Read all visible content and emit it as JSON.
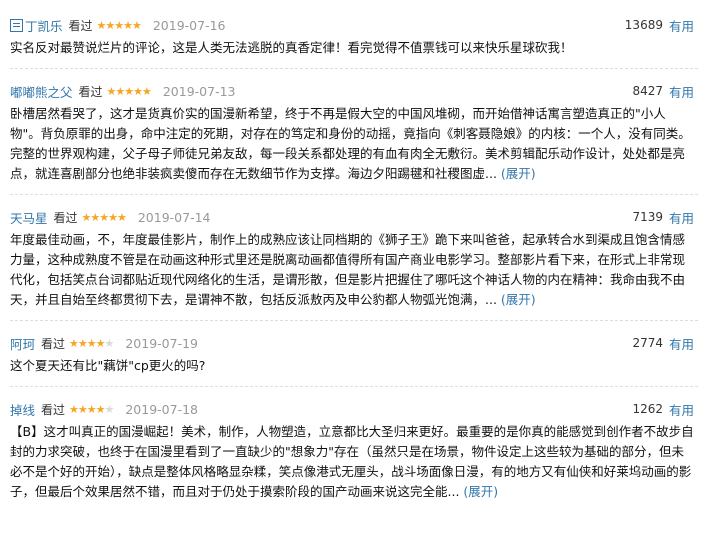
{
  "reviews": [
    {
      "user": "丁凯乐",
      "status": "看过",
      "rating": 5,
      "date": "2019-07-16",
      "votes": "13689",
      "useful_label": "有用",
      "text": "实名反对最赞说烂片的评论，这是人类无法逃脱的真香定律！看完觉得不值票钱可以来快乐星球砍我！",
      "expand": ""
    },
    {
      "user": "嘟嘟熊之父",
      "status": "看过",
      "rating": 5,
      "date": "2019-07-13",
      "votes": "8427",
      "useful_label": "有用",
      "text": "卧槽居然看哭了，这才是货真价实的国漫新希望，终于不再是假大空的中国风堆砌，而开始借神话寓言塑造真正的\"小人物\"。背负原罪的出身，命中注定的死期，对存在的笃定和身份的动摇，竟指向《刺客聂隐娘》的内核：一个人，没有同类。完整的世界观构建，父子母子师徒兄弟友敌，每一段关系都处理的有血有肉全无敷衍。美术剪辑配乐动作设计，处处都是亮点，就连喜剧部分也绝非装疯卖傻而存在无数细节作为支撑。海边夕阳踢毽和社稷图虚...",
      "expand": "(展开)"
    },
    {
      "user": "天马星",
      "status": "看过",
      "rating": 5,
      "date": "2019-07-14",
      "votes": "7139",
      "useful_label": "有用",
      "text": "年度最佳动画，不，年度最佳影片，制作上的成熟应该让同档期的《狮子王》跪下来叫爸爸，起承转合水到渠成且饱含情感力量，这种成熟度不管是在动画这种形式里还是脱离动画都值得所有国产商业电影学习。整部影片看下来，在形式上非常现代化，包括笑点台词都贴近现代网络化的生活，是谓形散，但是影片把握住了哪吒这个神话人物的内在精神：我命由我不由天，并且自始至终都贯彻下去，是谓神不散，包括反派敖丙及申公豹都人物弧光饱满，...",
      "expand": "(展开)"
    },
    {
      "user": "阿珂",
      "status": "看过",
      "rating": 4,
      "date": "2019-07-19",
      "votes": "2774",
      "useful_label": "有用",
      "text": "这个夏天还有比\"藕饼\"cp更火的吗?",
      "expand": ""
    },
    {
      "user": "掉线",
      "status": "看过",
      "rating": 4,
      "date": "2019-07-18",
      "votes": "1262",
      "useful_label": "有用",
      "text": "【B】这才叫真正的国漫崛起！美术，制作，人物塑造，立意都比大圣归来更好。最重要的是你真的能感觉到创作者不故步自封的力求突破，也终于在国漫里看到了一直缺少的\"想象力\"存在（虽然只是在场景，物件设定上这些较为基础的部分，但未必不是个好的开始），缺点是整体风格略显杂糅，笑点像港式无厘头，战斗场面像日漫，有的地方又有仙侠和好莱坞动画的影子，但最后个效果居然不错，而且对于仍处于摸索阶段的国产动画来说这完全能...",
      "expand": "(展开)"
    }
  ]
}
